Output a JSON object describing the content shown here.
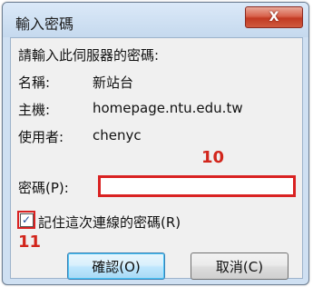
{
  "window": {
    "title": "輸入密碼",
    "close_glyph": "X"
  },
  "prompt": "請輸入此伺服器的密碼:",
  "fields": {
    "name_label": "名稱:",
    "name_value": "新站台",
    "host_label": "主機:",
    "host_value": "homepage.ntu.edu.tw",
    "user_label": "使用者:",
    "user_value": "chenyc",
    "password_label": "密碼(P):",
    "password_value": ""
  },
  "remember": {
    "label": "記住這次連線的密碼(R)",
    "checked": true,
    "check_glyph": "✓"
  },
  "annotations": {
    "password_number": "10",
    "checkbox_number": "11",
    "color": "#d2261c"
  },
  "buttons": {
    "ok_label": "確認(O)",
    "cancel_label": "取消(C)"
  }
}
